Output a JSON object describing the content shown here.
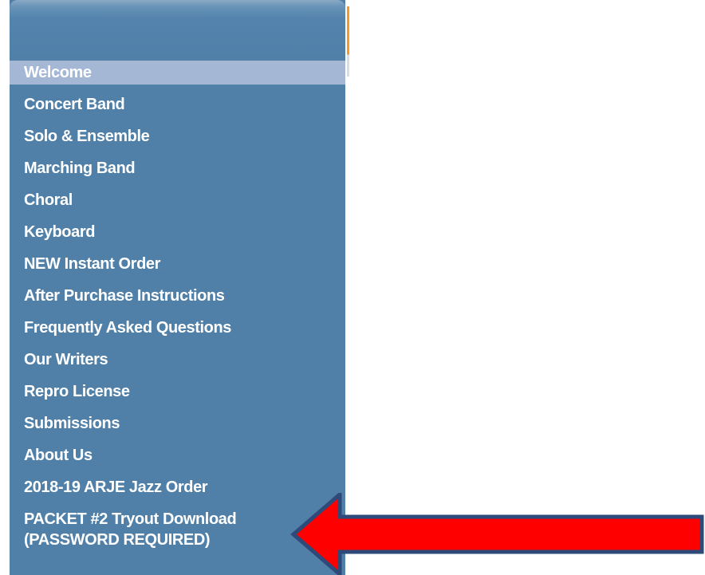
{
  "sidebar": {
    "items": [
      {
        "label": "Welcome",
        "active": true
      },
      {
        "label": "Concert Band"
      },
      {
        "label": "Solo & Ensemble"
      },
      {
        "label": "Marching Band"
      },
      {
        "label": "Choral"
      },
      {
        "label": "Keyboard"
      },
      {
        "label": "NEW Instant Order"
      },
      {
        "label": "After Purchase Instructions"
      },
      {
        "label": "Frequently Asked Questions"
      },
      {
        "label": "Our Writers"
      },
      {
        "label": "Repro License"
      },
      {
        "label": "Submissions"
      },
      {
        "label": "About Us"
      },
      {
        "label": "2018-19 ARJE Jazz Order"
      },
      {
        "label_line1": "PACKET #2 Tryout Download",
        "label_line2": "(PASSWORD REQUIRED)"
      }
    ]
  },
  "annotation": {
    "arrow_icon": "red-left-arrow-icon",
    "fill_color": "#ff0000",
    "stroke_color": "#2e4a7a"
  },
  "colors": {
    "nav_background": "#5080a8",
    "active_item": "#a4b8d6",
    "accent": "#f39a2e"
  }
}
